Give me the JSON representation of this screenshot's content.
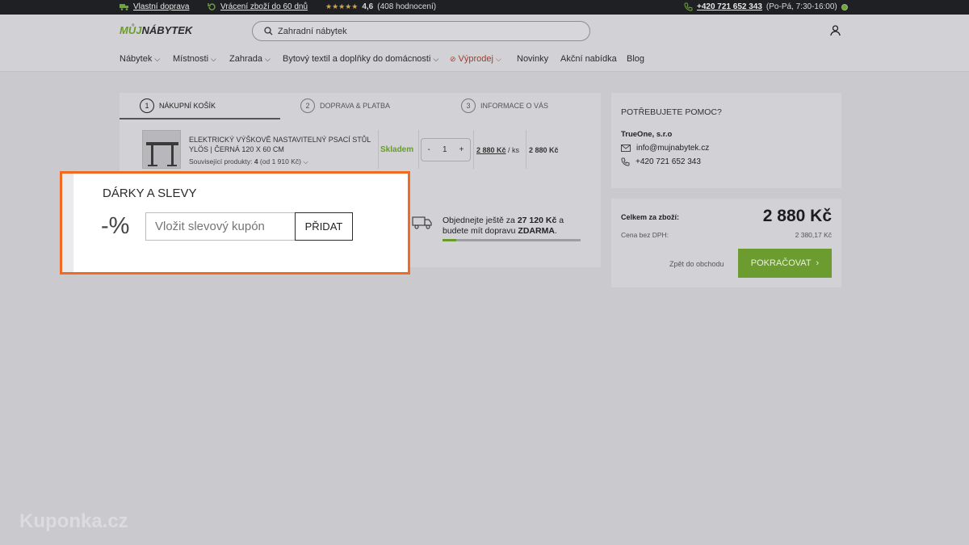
{
  "topbar": {
    "shipping": "Vlastní doprava",
    "returns": "Vrácení zboží do 60 dnů",
    "rating": "4,6",
    "reviews": "(408 hodnocení)",
    "phone": "+420 721 652 343",
    "hours": "(Po-Pá, 7:30-16:00)"
  },
  "header": {
    "logo_a": "MŮJ",
    "logo_b": "NÁBYTEK",
    "search_placeholder": "Zahradní nábytek"
  },
  "nav": {
    "items": [
      "Nábytek",
      "Místnosti",
      "Zahrada",
      "Bytový textil a doplňky do domácnosti",
      "Výprodej",
      "Novinky",
      "Akční nabídka",
      "Blog"
    ]
  },
  "steps": [
    {
      "num": "1",
      "label": "NÁKUPNÍ KOŠÍK"
    },
    {
      "num": "2",
      "label": "DOPRAVA & PLATBA"
    },
    {
      "num": "3",
      "label": "INFORMACE O VÁS"
    }
  ],
  "product": {
    "name": "ELEKTRICKÝ VÝŠKOVĚ NASTAVITELNÝ PSACÍ STŮL YLÖS | ČERNÁ 120 X 60 CM",
    "related_label": "Související produkty:",
    "related_count": "4",
    "related_price": "(od 1 910 Kč)",
    "stock": "Skladem",
    "qty": "1",
    "minus": "-",
    "plus": "+",
    "unit_price": "2 880 Kč",
    "unit_suffix": "/ ks",
    "total": "2 880 Kč"
  },
  "shipping": {
    "text_a": "Objednejte ještě za",
    "amount": "27 120 Kč",
    "text_b": "a",
    "text_c": "budete mít dopravu",
    "free": "ZDARMA",
    "progress": 0.1
  },
  "help": {
    "title": "POTŘEBUJETE POMOC?",
    "company": "TrueOne, s.r.o",
    "email": "info@mujnabytek.cz",
    "phone": "+420 721 652 343"
  },
  "summary": {
    "total_label": "Celkem za zboží:",
    "total": "2 880 Kč",
    "net_label": "Cena bez DPH:",
    "net": "2 380,17 Kč",
    "back": "Zpět do obchodu",
    "continue": "POKRAČOVAT"
  },
  "coupon": {
    "title": "DÁRKY A SLEVY",
    "symbol": "-%",
    "placeholder": "Vložit slevový kupón",
    "button": "PŘIDAT"
  },
  "watermark": "Kuponka.cz",
  "colors": {
    "accent": "#6a9a2e",
    "highlight": "#f26a21",
    "sale": "#a33a2a"
  }
}
